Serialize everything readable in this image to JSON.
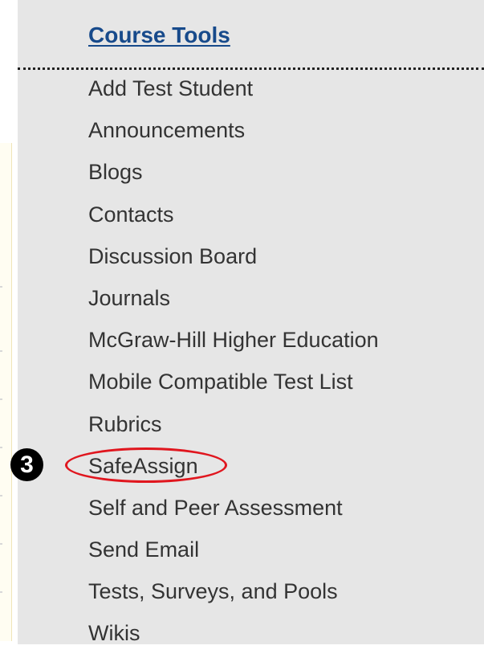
{
  "course_tools": {
    "title": "Course Tools",
    "items": [
      "Add Test Student",
      "Announcements",
      "Blogs",
      "Contacts",
      "Discussion Board",
      "Journals",
      "McGraw-Hill Higher Education",
      "Mobile Compatible Test List",
      "Rubrics",
      "SafeAssign",
      "Self and Peer Assessment",
      "Send Email",
      "Tests, Surveys, and Pools",
      "Wikis"
    ]
  },
  "annotation": {
    "step_number": "3",
    "highlighted_item": "SafeAssign",
    "highlight_color": "#e0161e"
  }
}
